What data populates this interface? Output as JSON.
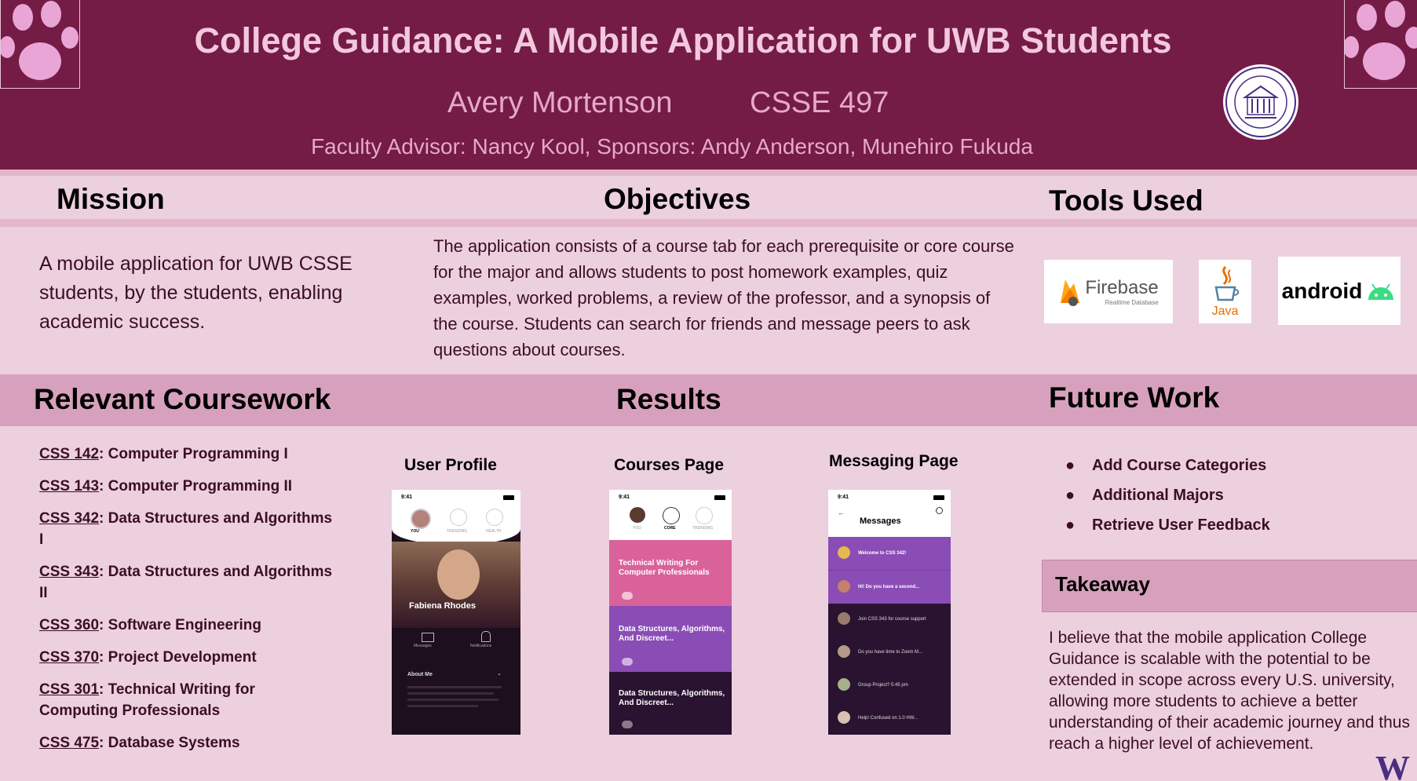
{
  "header": {
    "title": "College Guidance: A Mobile Application for UWB Students",
    "author": "Avery Mortenson",
    "course": "CSSE 497",
    "advisors": "Faculty Advisor: Nancy Kool, Sponsors: Andy Anderson, Munehiro Fukuda"
  },
  "mission": {
    "title": "Mission",
    "text": "A mobile application for UWB CSSE students, by the students, enabling academic success."
  },
  "objectives": {
    "title": "Objectives",
    "text": "The application consists of a course tab for each prerequisite or core course for the major and allows students to post homework examples, quiz examples, worked problems, a review of the professor, and a synopsis of the course. Students can search for friends and message peers to ask questions about courses."
  },
  "tools": {
    "title": "Tools Used",
    "firebase_name": "Firebase",
    "firebase_sub": "Realtime Database",
    "java_name": "Java",
    "android_name": "android"
  },
  "coursework": {
    "title": "Relevant Coursework",
    "items": [
      {
        "code": "CSS 142",
        "name": ": Computer Programming I"
      },
      {
        "code": "CSS 143",
        "name": ": Computer Programming II"
      },
      {
        "code": "CSS 342",
        "name": ": Data Structures and Algorithms I"
      },
      {
        "code": "CSS 343",
        "name": ": Data Structures and Algorithms II"
      },
      {
        "code": "CSS 360",
        "name": ": Software Engineering"
      },
      {
        "code": "CSS 370",
        "name": ": Project Development"
      },
      {
        "code": "CSS 301",
        "name": ": Technical Writing for Computing Professionals"
      },
      {
        "code": "CSS 475",
        "name": ": Database Systems"
      }
    ]
  },
  "results": {
    "title": "Results",
    "profile_label": "User Profile",
    "courses_label": "Courses Page",
    "messaging_label": "Messaging Page",
    "phone_time": "9:41",
    "profile": {
      "tabs": [
        "YOU",
        "TRENDING",
        "HEALTH"
      ],
      "user_name": "Fabiena Rhodes",
      "messages": "Messages",
      "notifications": "Notifications",
      "about": "About Me"
    },
    "courses": {
      "tabs": [
        "YOU",
        "CORE",
        "TRENDING"
      ],
      "cards": [
        {
          "title": "Technical Writing For Computer Professionals",
          "color": "#d9629b"
        },
        {
          "title": "Data Structures, Algorithms, And Discreet...",
          "color": "#8a4db5"
        },
        {
          "title": "Data Structures, Algorithms, And Discreet...",
          "color": "#2a1330"
        }
      ]
    },
    "messaging": {
      "header": "Messages",
      "rows": [
        {
          "text": "Welcome to CSS 342!",
          "highlight": true
        },
        {
          "text": "Hi! Do you have a second...",
          "highlight": true
        },
        {
          "text": "Join CSS 343 for course support",
          "highlight": false
        },
        {
          "text": "Do you have time to Zoom M...",
          "highlight": false
        },
        {
          "text": "Group Project? 5:45 pm",
          "highlight": false
        },
        {
          "text": "Help! Confused on 1.0 HW...",
          "highlight": false
        }
      ]
    }
  },
  "future": {
    "title": "Future Work",
    "items": [
      "Add Course Categories",
      "Additional Majors",
      "Retrieve User Feedback"
    ],
    "bullet": "●"
  },
  "takeaway": {
    "title": "Takeaway",
    "text": "I believe that the mobile application College Guidance is scalable with the potential to be extended in scope across every U.S. university, allowing more students to achieve a better understanding of their academic journey and thus reach a higher level of achievement."
  },
  "logo": {
    "letter": "W"
  },
  "colors": {
    "header_bg": "#741b46",
    "body_bg": "#ecd0dd",
    "band": "#d7a1bd",
    "uw_purple": "#4b2e83"
  }
}
